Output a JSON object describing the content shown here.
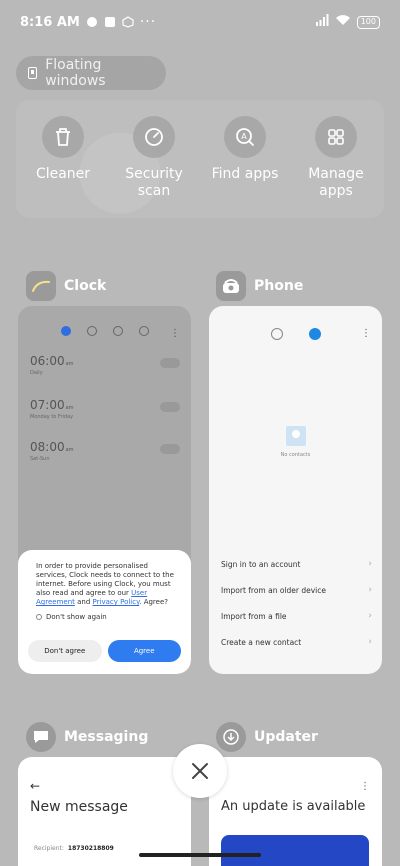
{
  "status_bar": {
    "time": "8:16 AM",
    "battery": "100"
  },
  "floating_windows": {
    "label": "Floating windows"
  },
  "quick_tools": [
    {
      "label": "Cleaner",
      "icon": "trash-icon"
    },
    {
      "label": "Security\nscan",
      "icon": "gauge-icon"
    },
    {
      "label": "Find apps",
      "icon": "search-app-icon"
    },
    {
      "label": "Manage\napps",
      "icon": "grid-icon"
    }
  ],
  "recents": {
    "clock": {
      "title": "Clock",
      "alarms": [
        {
          "time": "06:00",
          "ampm": "am",
          "sub": "Daily"
        },
        {
          "time": "07:00",
          "ampm": "am",
          "sub": "Monday to Friday"
        },
        {
          "time": "08:00",
          "ampm": "am",
          "sub": "Sat-Sun"
        }
      ],
      "dialog": {
        "text_before": "In order to provide personalised services, Clock needs to connect to the internet. Before using Clock, you must also read and agree to our",
        "link1": "User Agreement",
        "and": "and",
        "link2": "Privacy Policy",
        "text_after": ". Agree?",
        "dont_show": "Don't show again",
        "disagree": "Don't agree",
        "agree": "Agree"
      }
    },
    "phone": {
      "title": "Phone",
      "empty": "No contacts",
      "options": [
        "Sign in to an account",
        "Import from an older device",
        "Import from a file",
        "Create a new contact"
      ]
    },
    "messaging": {
      "title": "Messaging",
      "screen_title": "New message",
      "recipient_label": "Recipient:",
      "recipient_value": "18730218809"
    },
    "updater": {
      "title": "Updater",
      "screen_title": "An update is available"
    }
  },
  "colors": {
    "accent": "#2f7cf0",
    "dim_bg": "#b9b9b9"
  }
}
